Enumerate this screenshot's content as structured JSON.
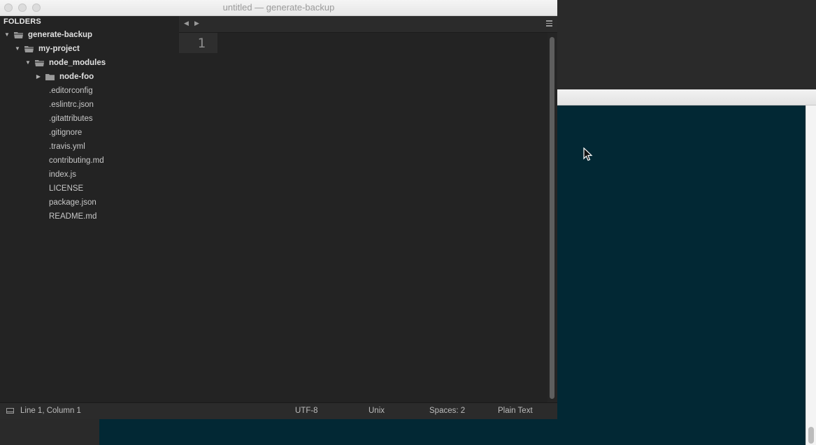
{
  "window": {
    "title": "untitled — generate-backup"
  },
  "sidebar": {
    "header": "FOLDERS",
    "tree": [
      {
        "label": "generate-backup",
        "type": "folder",
        "expanded": true,
        "depth": 0
      },
      {
        "label": "my-project",
        "type": "folder",
        "expanded": true,
        "depth": 1
      },
      {
        "label": "node_modules",
        "type": "folder",
        "expanded": true,
        "depth": 2
      },
      {
        "label": "node-foo",
        "type": "folder",
        "expanded": false,
        "depth": 3
      },
      {
        "label": ".editorconfig",
        "type": "file",
        "depth": 2
      },
      {
        "label": ".eslintrc.json",
        "type": "file",
        "depth": 2
      },
      {
        "label": ".gitattributes",
        "type": "file",
        "depth": 2
      },
      {
        "label": ".gitignore",
        "type": "file",
        "depth": 2
      },
      {
        "label": ".travis.yml",
        "type": "file",
        "depth": 2
      },
      {
        "label": "contributing.md",
        "type": "file",
        "depth": 2
      },
      {
        "label": "index.js",
        "type": "file",
        "depth": 2
      },
      {
        "label": "LICENSE",
        "type": "file",
        "depth": 2
      },
      {
        "label": "package.json",
        "type": "file",
        "depth": 2
      },
      {
        "label": "README.md",
        "type": "file",
        "depth": 2
      }
    ]
  },
  "editor": {
    "line_numbers": [
      "1"
    ],
    "content": ""
  },
  "statusbar": {
    "position": "Line 1, Column 1",
    "encoding": "UTF-8",
    "line_endings": "Unix",
    "indentation": "Spaces: 2",
    "syntax": "Plain Text"
  },
  "icons": {
    "tab_nav_left": "chevron-left-icon",
    "tab_nav_right": "chevron-right-icon",
    "tab_menu": "hamburger-menu-icon",
    "status_panel": "panel-toggle-icon",
    "folder": "folder-icon",
    "disclosure": "disclosure-triangle-icon",
    "cursor": "mouse-pointer-icon"
  },
  "colors": {
    "editor_bg": "#232323",
    "background_window": "#022834"
  }
}
